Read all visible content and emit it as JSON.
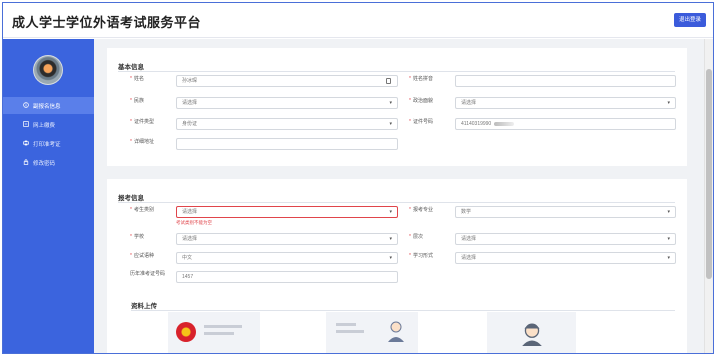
{
  "header": {
    "title": "成人学士学位外语考试服务平台",
    "logout_label": "退出登录"
  },
  "sidebar": {
    "items": [
      {
        "label": "副报名信息",
        "icon": "info-icon",
        "active": true
      },
      {
        "label": "网上缴费",
        "icon": "payment-icon",
        "active": false
      },
      {
        "label": "打印准考证",
        "icon": "print-icon",
        "active": false
      },
      {
        "label": "修改密码",
        "icon": "lock-icon",
        "active": false
      }
    ]
  },
  "basic": {
    "title": "基本信息",
    "name_label": "姓名",
    "name_value": "孙冰琛",
    "pinyin_label": "姓名拼音",
    "pinyin_value": "",
    "ethnicity_label": "民族",
    "ethnicity_value": "请选择",
    "political_label": "政治面貌",
    "political_value": "请选择",
    "idtype_label": "证件类型",
    "idtype_value": "身份证",
    "idnum_label": "证件号码",
    "idnum_value": "41140319990",
    "address_label": "详细地址",
    "address_value": ""
  },
  "exam": {
    "title": "报考信息",
    "category_label": "考生类别",
    "category_value": "请选择",
    "category_error": "考试类别不能为空",
    "major_label": "报考专业",
    "major_value": "数学",
    "school_label": "学校",
    "school_value": "请选择",
    "level_label": "层次",
    "level_value": "请选择",
    "language_label": "应试语种",
    "language_value": "中文",
    "study_label": "学习形式",
    "study_value": "请选择",
    "prev_label": "历年准考证号码",
    "prev_value": "1457"
  },
  "upload": {
    "title": "资料上传"
  }
}
